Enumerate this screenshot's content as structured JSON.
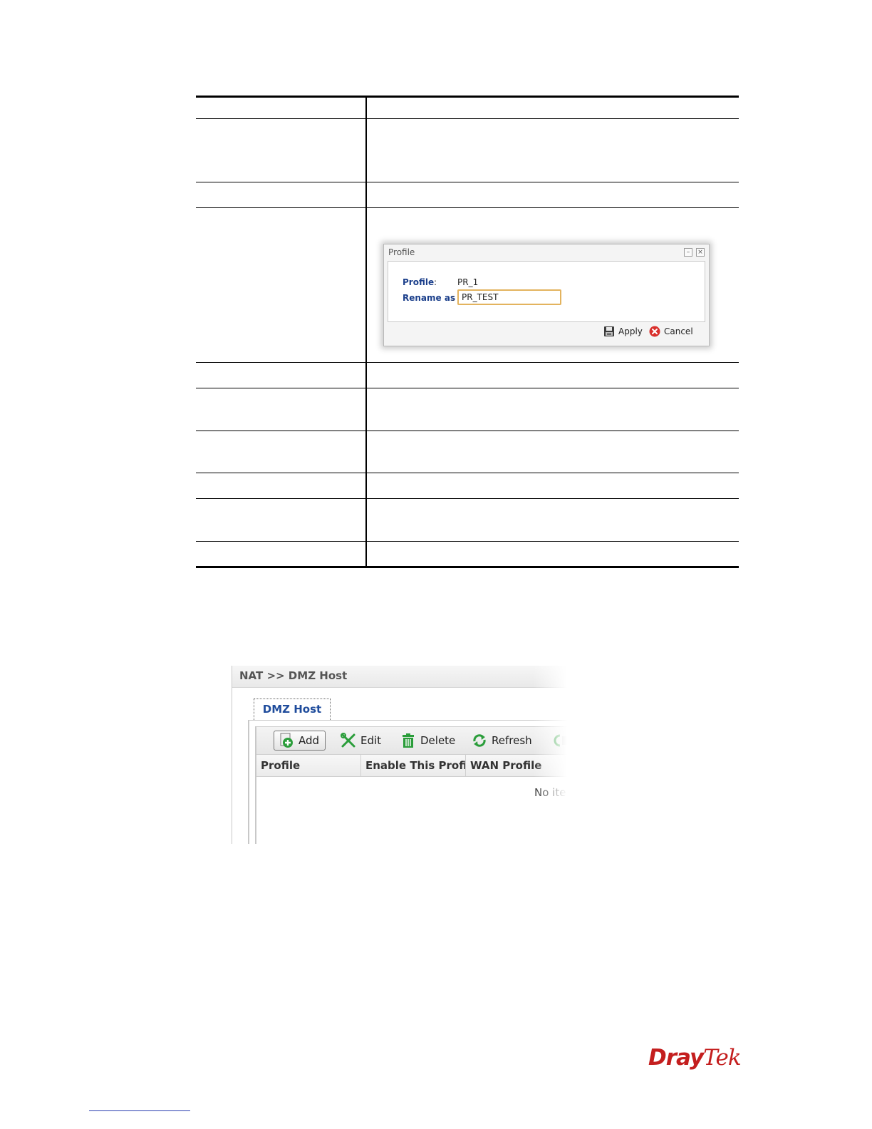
{
  "dialog": {
    "title": "Profile",
    "profile_label": "Profile",
    "profile_value": "PR_1",
    "rename_label": "Rename as",
    "rename_value": "PR_TEST",
    "apply_label": "Apply",
    "cancel_label": "Cancel",
    "minimize_glyph": "–",
    "close_glyph": "×"
  },
  "dmz": {
    "breadcrumb": "NAT >> DMZ Host",
    "tab_label": "DMZ Host",
    "toolbar": {
      "add_label": "Add",
      "edit_label": "Edit",
      "delete_label": "Delete",
      "refresh_label": "Refresh"
    },
    "columns": [
      "Profile",
      "Enable This Profile",
      "WAN Profile"
    ],
    "empty_text": "No item"
  },
  "logo": {
    "part1": "Dray",
    "part2": "Tek"
  },
  "colors": {
    "label_blue": "#1b3f8b",
    "tab_blue": "#1f4c9c",
    "input_border": "#e3b35e",
    "logo_red": "#c41e1e",
    "cancel_red": "#d9302c",
    "icon_green": "#2a9d3a"
  }
}
